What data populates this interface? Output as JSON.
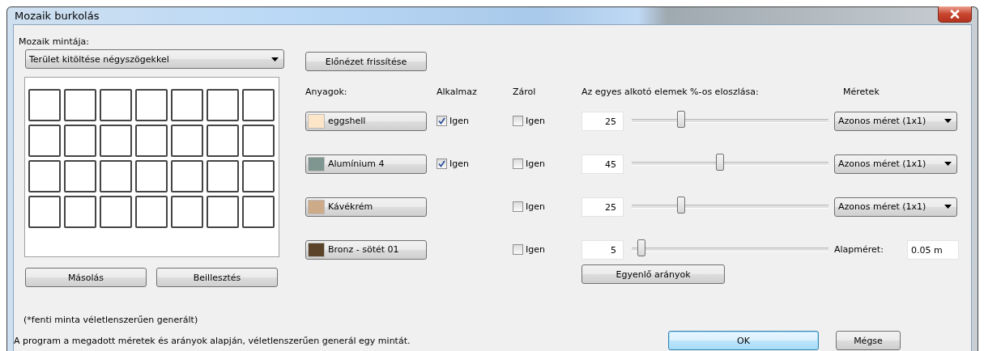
{
  "window": {
    "title": "Mozaik burkolás"
  },
  "pattern": {
    "label": "Mozaik mintája:",
    "value": "Terület kitöltése négyszögekkel"
  },
  "refresh_button": "Előnézet frissítése",
  "columns": [
    "Anyagok:",
    "Alkalmaz",
    "Zárol",
    "Az egyes alkotó elemek %-os eloszlása:",
    "Méretek"
  ],
  "materials": [
    {
      "name": "eggshell",
      "color": "#fde6c8",
      "apply": {
        "label": "Igen",
        "checked": true
      },
      "lock": {
        "label": "Igen",
        "checked": false
      },
      "percent": "25",
      "level": 0.25,
      "size": "Azonos méret (1x1)"
    },
    {
      "name": "Alumínium 4",
      "color": "#7f9690",
      "apply": {
        "label": "Igen",
        "checked": true
      },
      "lock": {
        "label": "Igen",
        "checked": false
      },
      "percent": "45",
      "level": 0.45,
      "size": "Azonos méret (1x1)"
    },
    {
      "name": "Kávékrém",
      "color": "#cdaa88",
      "lock": {
        "label": "Igen",
        "checked": false
      },
      "percent": "25",
      "level": 0.25,
      "size": "Azonos méret (1x1)"
    },
    {
      "name": "Bronz - sötét 01",
      "color": "#5a4328",
      "lock": {
        "label": "Igen",
        "checked": false
      },
      "percent": "5",
      "level": 0.05,
      "base_size": {
        "label": "Alapméret:",
        "value": "0.05 m"
      }
    }
  ],
  "copy_button": "Másolás",
  "paste_button": "Beillesztés",
  "equal_button": "Egyenlő arányok",
  "note": "(*fenti minta véletlenszerűen generált)",
  "status": "A program a megadott méretek és arányok alapján, véletlenszerűen generál egy mintát.",
  "ok_button": "OK",
  "cancel_button": "Mégse"
}
